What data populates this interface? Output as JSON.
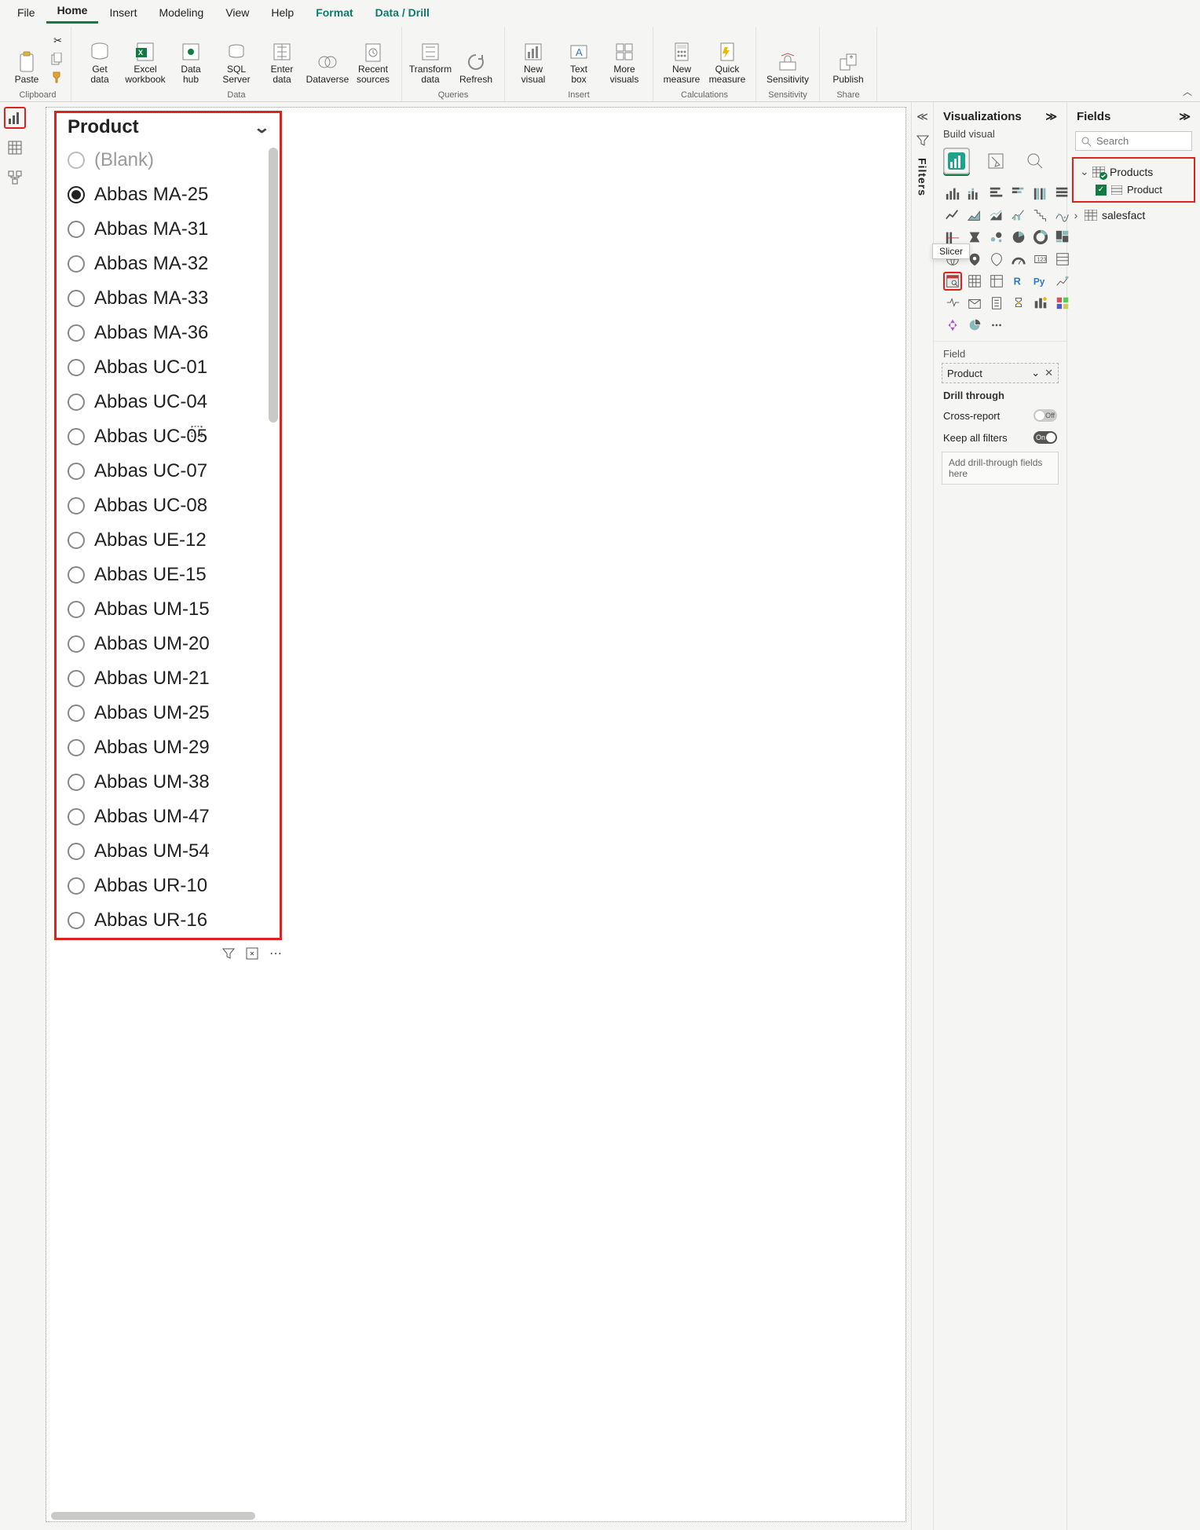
{
  "ribbon": {
    "tabs": [
      "File",
      "Home",
      "Insert",
      "Modeling",
      "View",
      "Help",
      "Format",
      "Data / Drill"
    ],
    "active_tab": "Home",
    "context_tabs": [
      "Format",
      "Data / Drill"
    ],
    "groups": {
      "clipboard": {
        "label": "Clipboard",
        "paste": "Paste"
      },
      "data": {
        "label": "Data",
        "get_data": "Get\ndata",
        "excel_workbook": "Excel\nworkbook",
        "data_hub": "Data\nhub",
        "sql_server": "SQL\nServer",
        "enter_data": "Enter\ndata",
        "dataverse": "Dataverse",
        "recent_sources": "Recent\nsources"
      },
      "queries": {
        "label": "Queries",
        "transform_data": "Transform\ndata",
        "refresh": "Refresh"
      },
      "insert": {
        "label": "Insert",
        "new_visual": "New\nvisual",
        "text_box": "Text\nbox",
        "more_visuals": "More\nvisuals"
      },
      "calculations": {
        "label": "Calculations",
        "new_measure": "New\nmeasure",
        "quick_measure": "Quick\nmeasure"
      },
      "sensitivity": {
        "label": "Sensitivity",
        "btn": "Sensitivity"
      },
      "share": {
        "label": "Share",
        "publish": "Publish"
      }
    }
  },
  "filters": {
    "label": "Filters"
  },
  "slicer": {
    "title": "Product",
    "selected_index": 1,
    "items": [
      {
        "label": "(Blank)",
        "dim": true
      },
      {
        "label": "Abbas MA-25"
      },
      {
        "label": "Abbas MA-31"
      },
      {
        "label": "Abbas MA-32"
      },
      {
        "label": "Abbas MA-33"
      },
      {
        "label": "Abbas MA-36"
      },
      {
        "label": "Abbas UC-01"
      },
      {
        "label": "Abbas UC-04"
      },
      {
        "label": "Abbas UC-05"
      },
      {
        "label": "Abbas UC-07"
      },
      {
        "label": "Abbas UC-08"
      },
      {
        "label": "Abbas UE-12"
      },
      {
        "label": "Abbas UE-15"
      },
      {
        "label": "Abbas UM-15"
      },
      {
        "label": "Abbas UM-20"
      },
      {
        "label": "Abbas UM-21"
      },
      {
        "label": "Abbas UM-25"
      },
      {
        "label": "Abbas UM-29"
      },
      {
        "label": "Abbas UM-38"
      },
      {
        "label": "Abbas UM-47"
      },
      {
        "label": "Abbas UM-54"
      },
      {
        "label": "Abbas UR-10"
      },
      {
        "label": "Abbas UR-16"
      }
    ]
  },
  "viz": {
    "title": "Visualizations",
    "subtitle": "Build visual",
    "tooltip": "Slicer",
    "field_section": "Field",
    "field_value": "Product",
    "drill": {
      "title": "Drill through",
      "cross_report": "Cross-report",
      "cross_report_state": "Off",
      "keep_filters": "Keep all filters",
      "keep_filters_state": "On",
      "drop_hint": "Add drill-through fields here"
    }
  },
  "fields": {
    "title": "Fields",
    "search_placeholder": "Search",
    "tables": {
      "products": {
        "name": "Products",
        "expanded": true,
        "columns": [
          {
            "name": "Product",
            "checked": true
          }
        ]
      },
      "salesfact": {
        "name": "salesfact",
        "expanded": false
      }
    }
  }
}
